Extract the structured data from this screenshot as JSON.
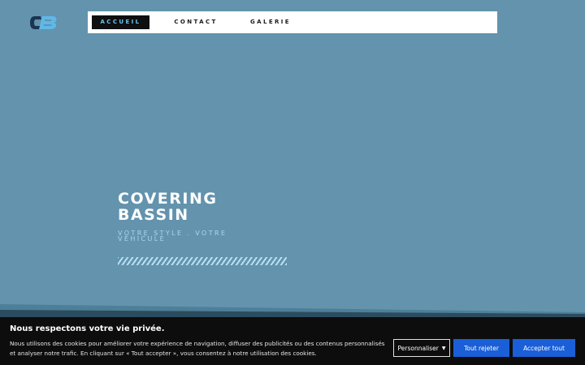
{
  "brand": {
    "logo_icon": "cb-logo-icon",
    "accent_color": "#6cc4ef"
  },
  "nav": {
    "items": [
      {
        "label": "Accueil",
        "active": true
      },
      {
        "label": "Contact",
        "active": false
      },
      {
        "label": "Galerie",
        "active": false
      }
    ]
  },
  "hero": {
    "title": "COVERING BASSIN",
    "subtitle": "Votre style . Votre véhicule"
  },
  "cookie": {
    "title": "Nous respectons votre vie privée.",
    "text": "Nous utilisons des cookies pour améliorer votre expérience de navigation, diffuser des publicités ou des contenus personnalisés et analyser notre trafic. En cliquant sur « Tout accepter », vous consentez à notre utilisation des cookies.",
    "customize_label": "Personnaliser",
    "customize_icon": "caret-down-icon",
    "reject_label": "Tout rejeter",
    "accept_label": "Accepter tout",
    "button_color": "#1a5fd8"
  }
}
